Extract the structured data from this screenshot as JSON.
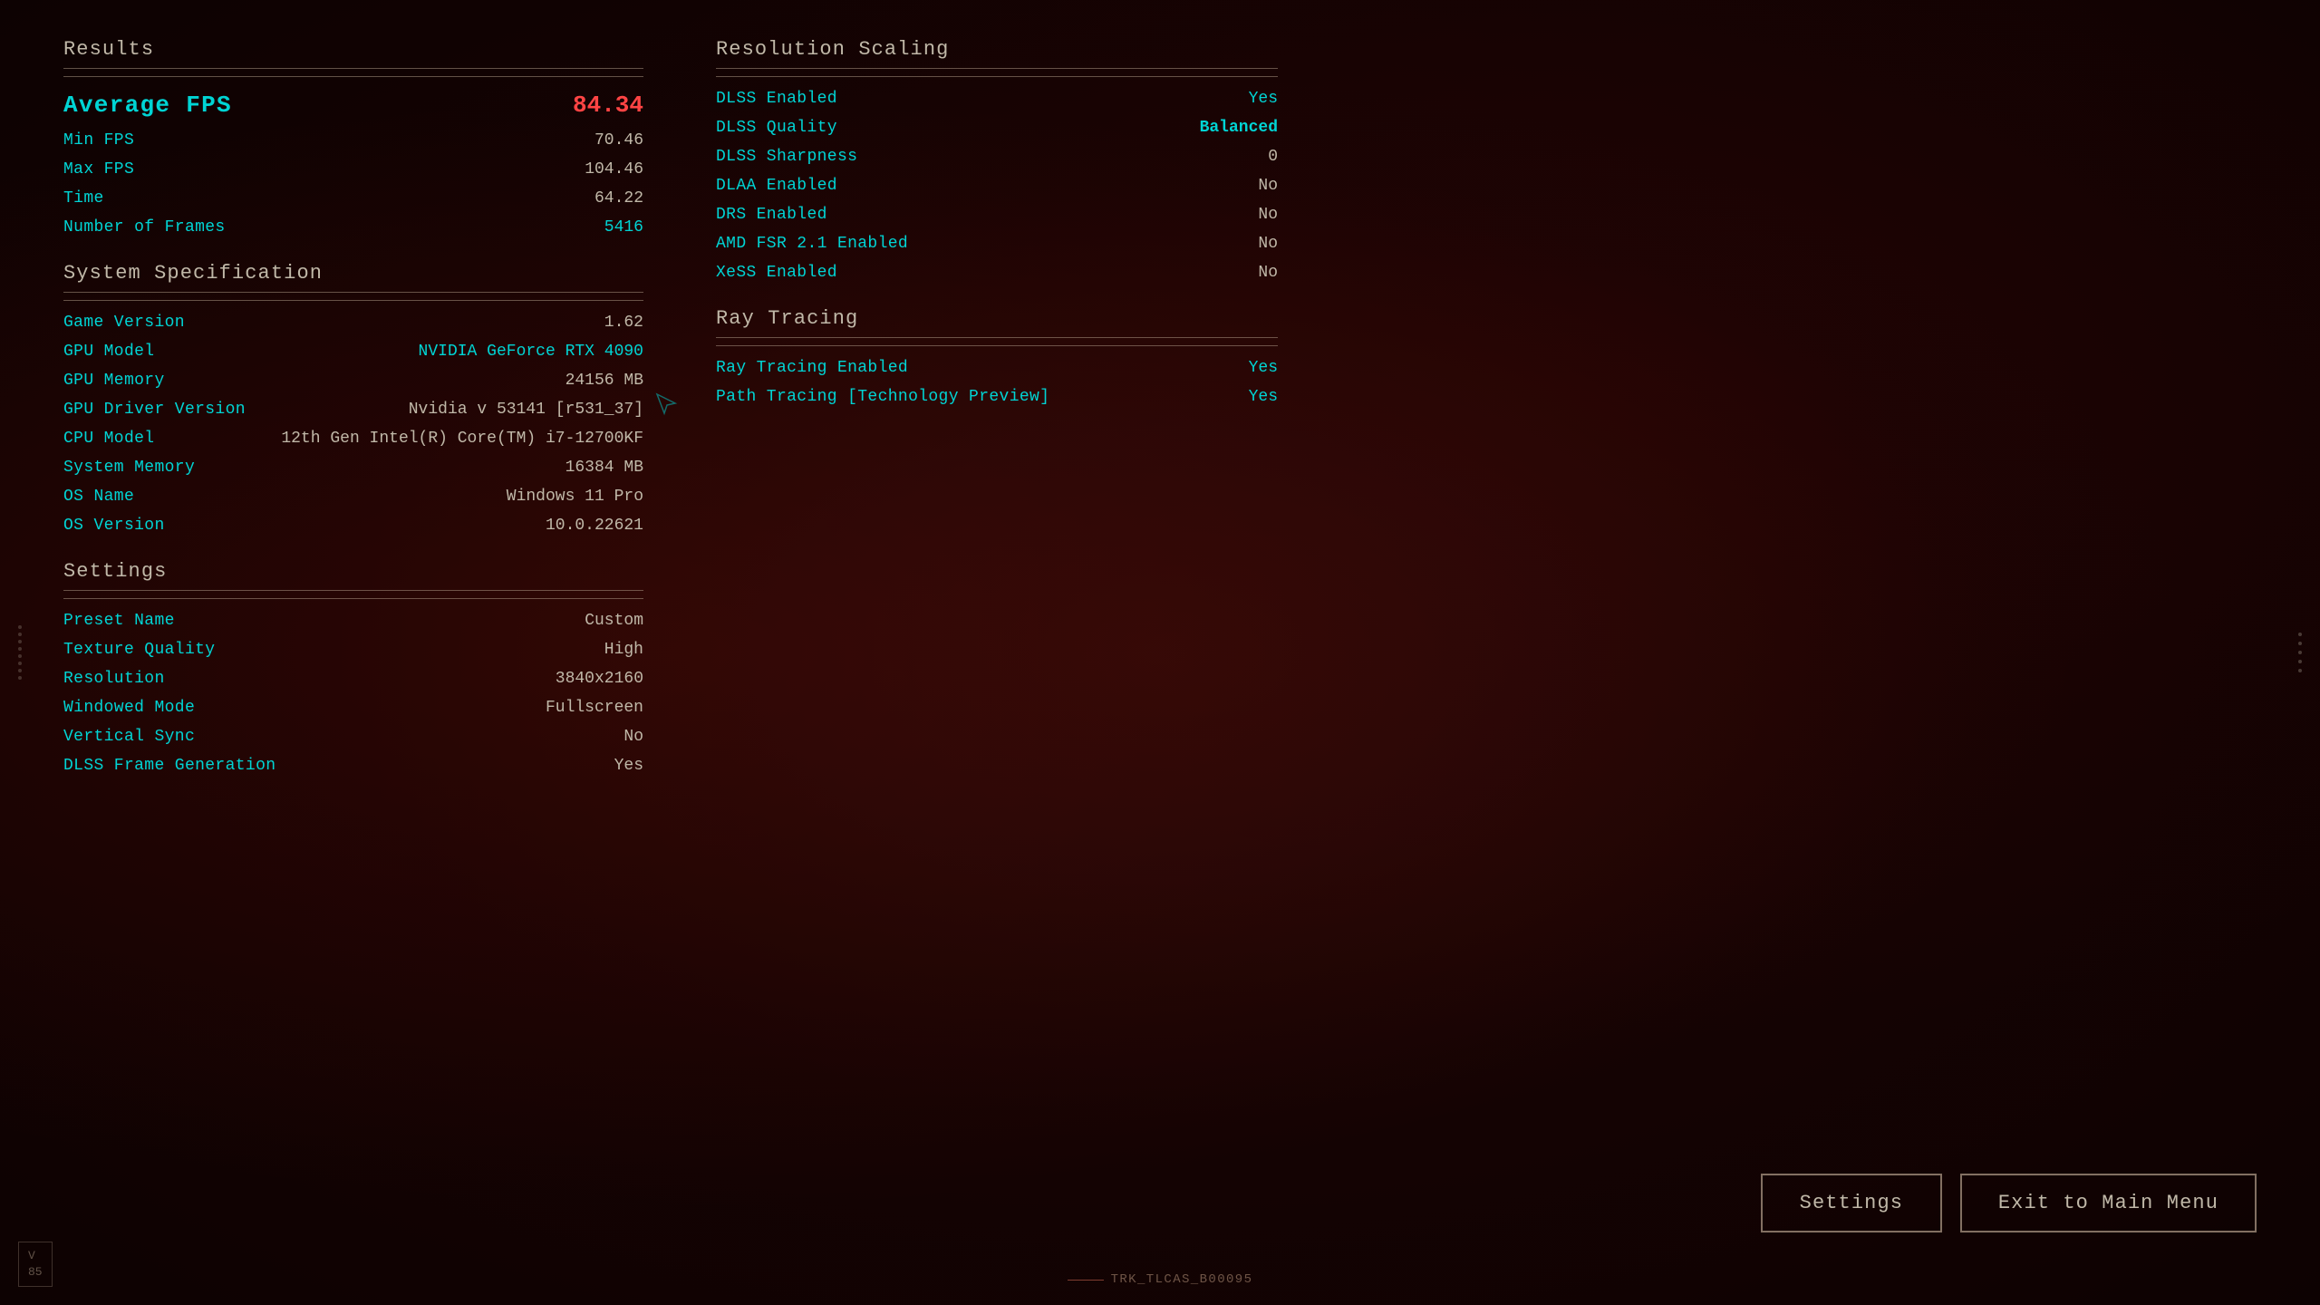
{
  "left": {
    "results": {
      "section_title": "Results",
      "average_fps_label": "Average FPS",
      "average_fps_value": "84.34",
      "rows": [
        {
          "label": "Min FPS",
          "value": "70.46"
        },
        {
          "label": "Max FPS",
          "value": "104.46"
        },
        {
          "label": "Time",
          "value": "64.22"
        },
        {
          "label": "Number of Frames",
          "value": "5416"
        }
      ]
    },
    "system": {
      "section_title": "System Specification",
      "rows": [
        {
          "label": "Game Version",
          "value": "1.62"
        },
        {
          "label": "GPU Model",
          "value": "NVIDIA GeForce RTX 4090",
          "accent": true
        },
        {
          "label": "GPU Memory",
          "value": "24156 MB"
        },
        {
          "label": "GPU Driver Version",
          "value": "Nvidia v 53141 [r531_37]"
        },
        {
          "label": "CPU Model",
          "value": "12th Gen Intel(R) Core(TM) i7-12700KF"
        },
        {
          "label": "System Memory",
          "value": "16384 MB"
        },
        {
          "label": "OS Name",
          "value": "Windows 11 Pro"
        },
        {
          "label": "OS Version",
          "value": "10.0.22621"
        }
      ]
    },
    "settings": {
      "section_title": "Settings",
      "rows": [
        {
          "label": "Preset Name",
          "value": "Custom"
        },
        {
          "label": "Texture Quality",
          "value": "High"
        },
        {
          "label": "Resolution",
          "value": "3840x2160"
        },
        {
          "label": "Windowed Mode",
          "value": "Fullscreen"
        },
        {
          "label": "Vertical Sync",
          "value": "No"
        },
        {
          "label": "DLSS Frame Generation",
          "value": "Yes"
        }
      ]
    }
  },
  "right": {
    "resolution_scaling": {
      "section_title": "Resolution Scaling",
      "rows": [
        {
          "label": "DLSS Enabled",
          "value": "Yes",
          "style": "yes"
        },
        {
          "label": "DLSS Quality",
          "value": "Balanced",
          "style": "balanced"
        },
        {
          "label": "DLSS Sharpness",
          "value": "0"
        },
        {
          "label": "DLAA Enabled",
          "value": "No"
        },
        {
          "label": "DRS Enabled",
          "value": "No"
        },
        {
          "label": "AMD FSR 2.1 Enabled",
          "value": "No"
        },
        {
          "label": "XeSS Enabled",
          "value": "No"
        }
      ]
    },
    "ray_tracing": {
      "section_title": "Ray Tracing",
      "rows": [
        {
          "label": "Ray Tracing Enabled",
          "value": "Yes",
          "style": "yes"
        },
        {
          "label": "Path Tracing [Technology Preview]",
          "value": "Yes",
          "style": "yes"
        }
      ]
    }
  },
  "buttons": {
    "settings_label": "Settings",
    "exit_label": "Exit to Main Menu"
  },
  "bottom": {
    "track_id": "TRK_TLCAS_B00095"
  },
  "version": {
    "label": "V",
    "number": "85"
  }
}
